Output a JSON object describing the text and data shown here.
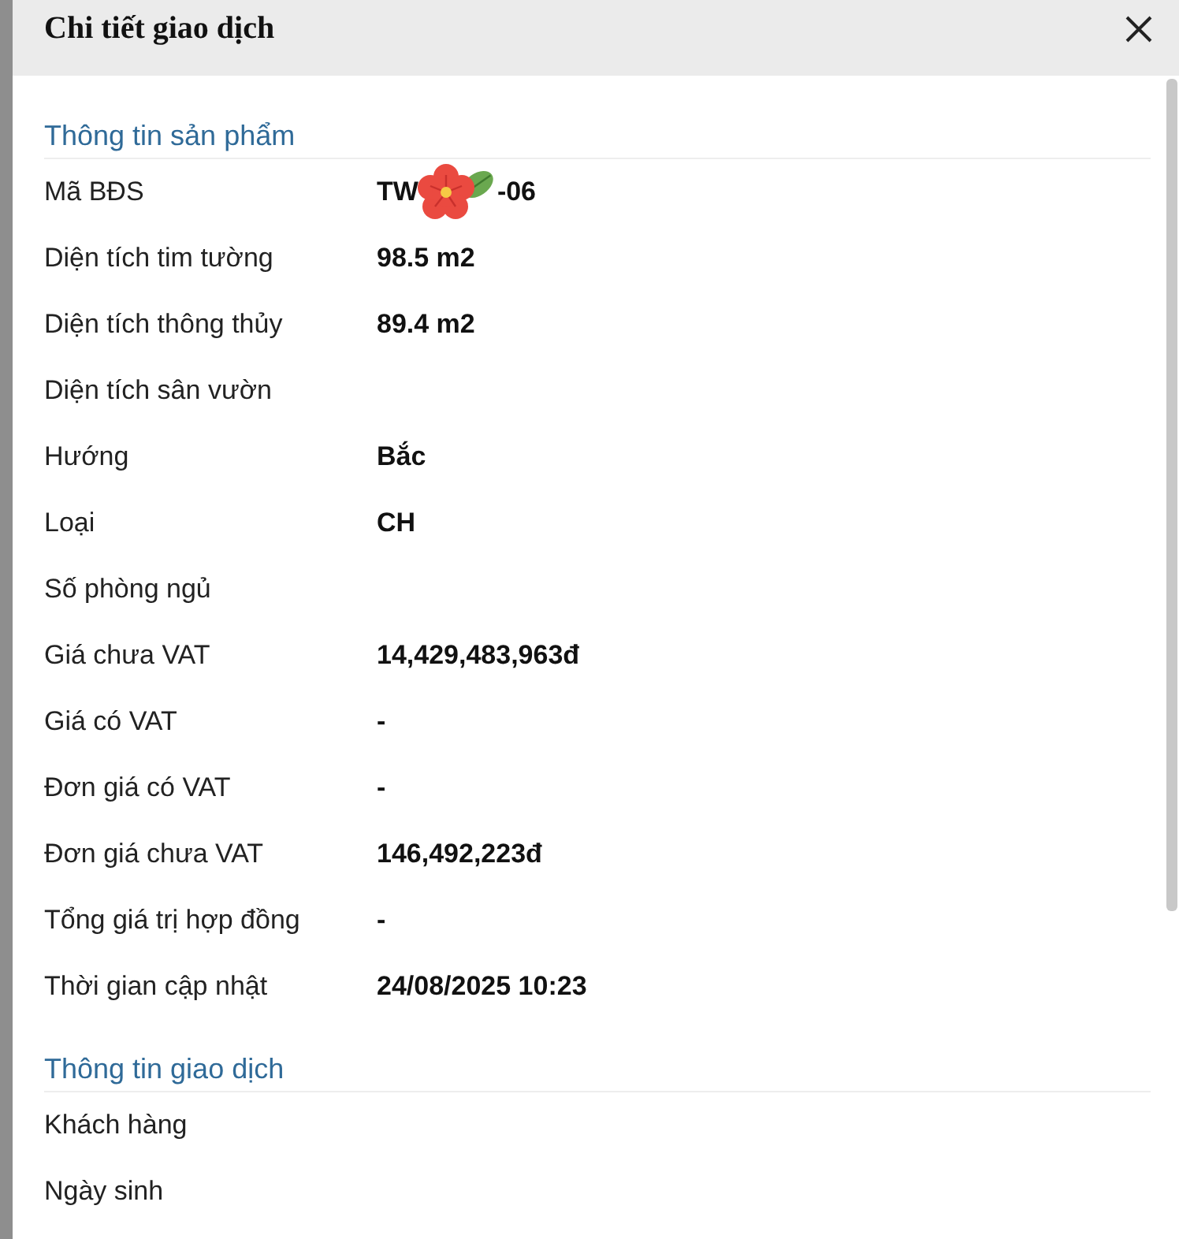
{
  "dialog": {
    "title": "Chi tiết giao dịch"
  },
  "sections": [
    {
      "heading": "Thông tin sản phẩm",
      "rows": [
        {
          "label": "Mã BĐS",
          "value_parts": [
            "TW",
            "-06"
          ]
        },
        {
          "label": "Diện tích tim tường",
          "value": "98.5 m2"
        },
        {
          "label": "Diện tích thông thủy",
          "value": "89.4 m2"
        },
        {
          "label": "Diện tích sân vườn"
        },
        {
          "label": "Hướng",
          "value": "Bắc"
        },
        {
          "label": "Loại",
          "value": "CH"
        },
        {
          "label": "Số phòng ngủ"
        },
        {
          "label": "Giá chưa VAT",
          "value": "14,429,483,963đ"
        },
        {
          "label": "Giá có VAT",
          "value": "-"
        },
        {
          "label": "Đơn giá có VAT",
          "value": "-"
        },
        {
          "label": "Đơn giá chưa VAT",
          "value": "146,492,223đ"
        },
        {
          "label": "Tổng giá trị hợp đồng",
          "value": "-"
        },
        {
          "label": "Thời gian cập nhật",
          "value": "24/08/2025 10:23"
        }
      ]
    },
    {
      "heading": "Thông tin giao dịch",
      "rows": [
        {
          "label": "Khách hàng"
        },
        {
          "label": "Ngày sinh"
        }
      ]
    }
  ]
}
